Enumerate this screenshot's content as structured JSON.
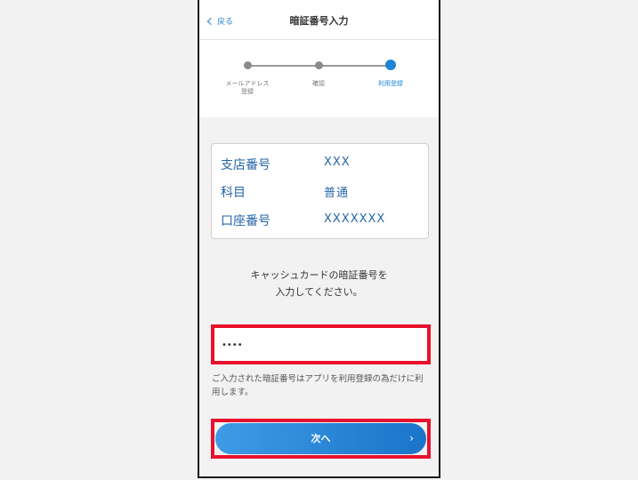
{
  "header": {
    "back_label": "戻る",
    "title": "暗証番号入力"
  },
  "stepper": {
    "steps": [
      {
        "label": "メールアドレス\n登録",
        "state": "done"
      },
      {
        "label": "確認",
        "state": "done"
      },
      {
        "label": "利用登録",
        "state": "current"
      }
    ]
  },
  "account_info": {
    "branch_label": "支店番号",
    "branch_value": "XXX",
    "type_label": "科目",
    "type_value": "普通",
    "account_label": "口座番号",
    "account_value": "XXXXXXX"
  },
  "prompt": {
    "line1": "キャッシュカードの暗証番号を",
    "line2": "入力してください。"
  },
  "pin": {
    "value": "••••"
  },
  "note": "ご入力された暗証番号はアプリを利用登録の為だけに利用します。",
  "next_button": {
    "label": "次へ",
    "arrow": "›"
  },
  "colors": {
    "accent": "#1f86d6",
    "highlight": "#e8112d",
    "text_blue": "#2566a8"
  }
}
